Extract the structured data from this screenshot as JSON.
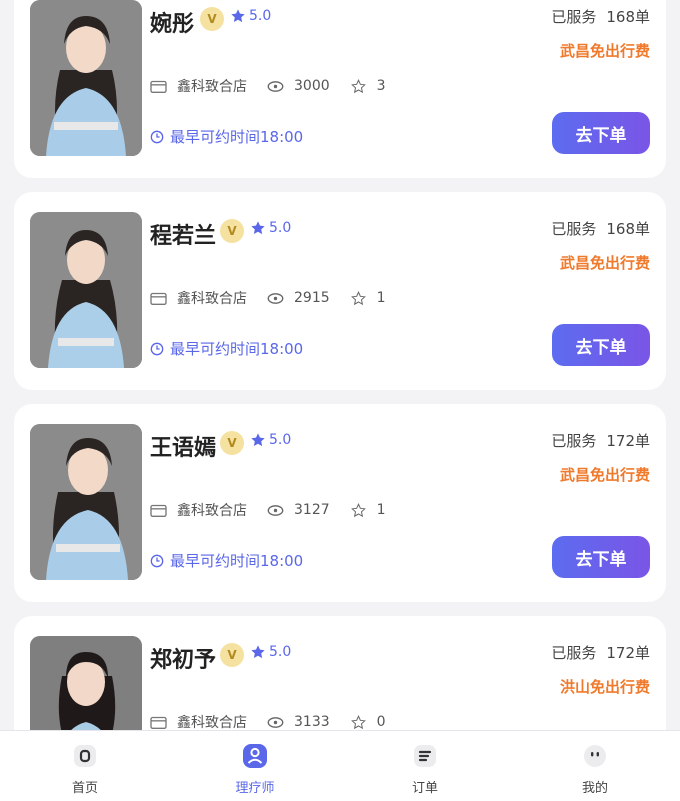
{
  "therapists": [
    {
      "name": "婉彤",
      "badge": "V",
      "rating": "5.0",
      "store": "鑫科致合店",
      "views": "3000",
      "favorites": "3",
      "earliest": "最早可约时间18:00",
      "served_label": "已服务",
      "served_count": "168单",
      "travel": "武昌免出行费",
      "action": "去下单"
    },
    {
      "name": "程若兰",
      "badge": "V",
      "rating": "5.0",
      "store": "鑫科致合店",
      "views": "2915",
      "favorites": "1",
      "earliest": "最早可约时间18:00",
      "served_label": "已服务",
      "served_count": "168单",
      "travel": "武昌免出行费",
      "action": "去下单"
    },
    {
      "name": "王语嫣",
      "badge": "V",
      "rating": "5.0",
      "store": "鑫科致合店",
      "views": "3127",
      "favorites": "1",
      "earliest": "最早可约时间18:00",
      "served_label": "已服务",
      "served_count": "172单",
      "travel": "武昌免出行费",
      "action": "去下单"
    },
    {
      "name": "郑初予",
      "badge": "V",
      "rating": "5.0",
      "store": "鑫科致合店",
      "views": "3133",
      "favorites": "0",
      "earliest": "",
      "served_label": "已服务",
      "served_count": "172单",
      "travel": "洪山免出行费",
      "action": ""
    }
  ],
  "tabbar": [
    {
      "label": "首页",
      "icon": "home-icon"
    },
    {
      "label": "理疗师",
      "icon": "therapist-icon"
    },
    {
      "label": "订单",
      "icon": "order-icon"
    },
    {
      "label": "我的",
      "icon": "profile-icon"
    }
  ],
  "colors": {
    "accent": "#5a67e8",
    "orange": "#f07a2c",
    "button_gradient_start": "#5c6cf0",
    "button_gradient_end": "#7a55e6"
  }
}
